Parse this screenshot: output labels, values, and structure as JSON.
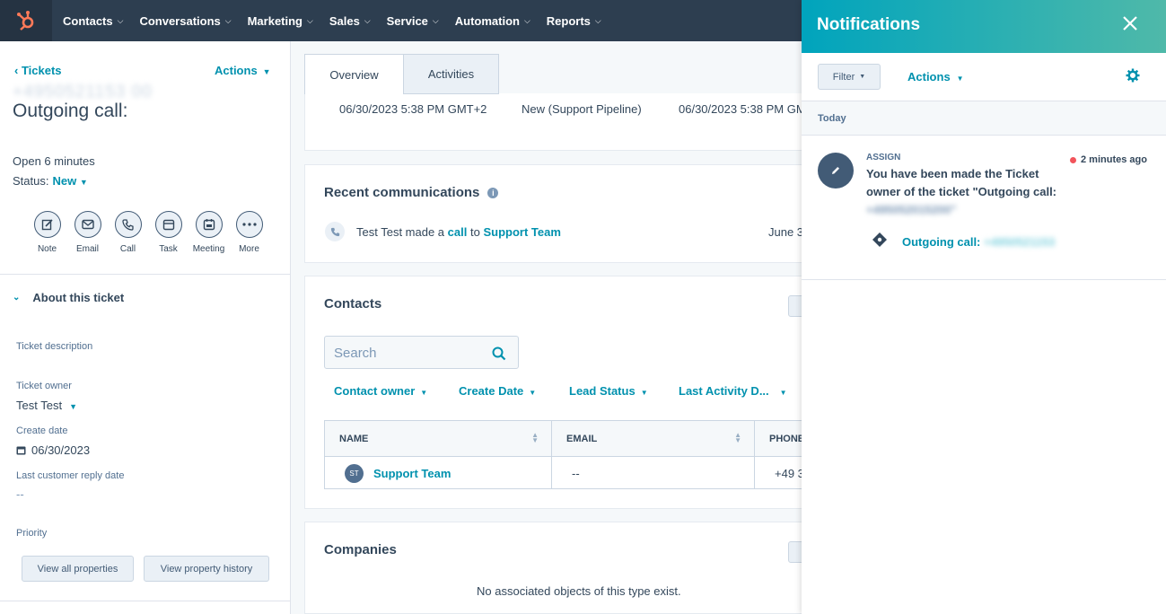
{
  "nav": {
    "items": [
      "Contacts",
      "Conversations",
      "Marketing",
      "Sales",
      "Service",
      "Automation",
      "Reports"
    ]
  },
  "left": {
    "back_label": "Tickets",
    "actions_label": "Actions",
    "title": "Outgoing call:",
    "title_sub": "+4950521153 00",
    "open_label": "Open 6 minutes",
    "status_label": "Status:",
    "status_value": "New",
    "activity_buttons": [
      "Note",
      "Email",
      "Call",
      "Task",
      "Meeting",
      "More"
    ],
    "about_label": "About this ticket",
    "props": {
      "description_label": "Ticket description",
      "owner_label": "Ticket owner",
      "owner_value": "Test Test",
      "create_label": "Create date",
      "create_value": "06/30/2023",
      "reply_label": "Last customer reply date",
      "reply_value": "--",
      "priority_label": "Priority"
    },
    "view_all_label": "View all properties",
    "view_history_label": "View property history"
  },
  "center": {
    "tabs": [
      "Overview",
      "Activities"
    ],
    "summary": [
      "06/30/2023 5:38 PM GMT+2",
      "New (Support Pipeline)",
      "06/30/2023 5:38 PM GM"
    ],
    "recent": {
      "title": "Recent communications",
      "line_prefix": "Test Test made a",
      "line_call": "call",
      "line_to": "to",
      "line_target": "Support Team",
      "line_date": "June 3"
    },
    "contacts": {
      "title": "Contacts",
      "search_placeholder": "Search",
      "filters": [
        "Contact owner",
        "Create Date",
        "Lead Status",
        "Last Activity D..."
      ],
      "columns": [
        "NAME",
        "EMAIL",
        "PHONE"
      ],
      "rows": [
        {
          "initials": "ST",
          "name": "Support Team",
          "email": "--",
          "phone": "+49 3"
        }
      ]
    },
    "companies": {
      "title": "Companies",
      "empty": "No associated objects of this type exist."
    }
  },
  "notifications": {
    "title": "Notifications",
    "filter_label": "Filter",
    "actions_label": "Actions",
    "section": "Today",
    "item": {
      "type": "ASSIGN",
      "time": "2 minutes ago",
      "message": "You have been made the Ticket owner of the ticket \"Outgoing call:",
      "message_blur": "+495052015200\"",
      "link_label": "Outgoing call:",
      "link_blur": "+4950521153"
    }
  },
  "colors": {
    "nav_bg": "#2d3e50",
    "accent": "#0091ae",
    "brand": "#ff7a59",
    "header_gradient_start": "#00a4bd",
    "header_gradient_end": "#4fb9a9"
  }
}
